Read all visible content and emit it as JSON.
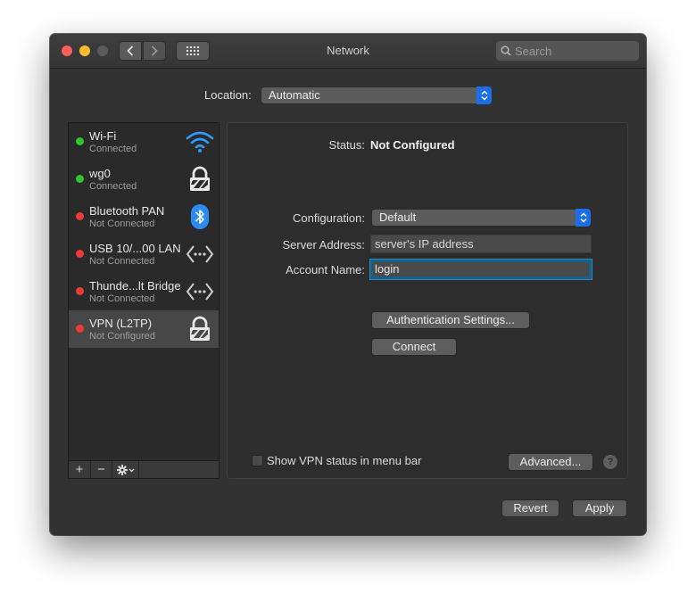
{
  "window": {
    "title": "Network"
  },
  "toolbar": {
    "search_placeholder": "Search"
  },
  "location": {
    "label": "Location:",
    "value": "Automatic"
  },
  "services": [
    {
      "name": "Wi-Fi",
      "status": "Connected",
      "status_color": "#2fc52e",
      "icon": "wifi-icon"
    },
    {
      "name": "wg0",
      "status": "Connected",
      "status_color": "#2fc52e",
      "icon": "lock-icon"
    },
    {
      "name": "Bluetooth PAN",
      "status": "Not Connected",
      "status_color": "#ef3b36",
      "icon": "bluetooth-icon"
    },
    {
      "name": "USB 10/...00 LAN",
      "status": "Not Connected",
      "status_color": "#ef3b36",
      "icon": "ethernet-icon"
    },
    {
      "name": "Thunde...lt Bridge",
      "status": "Not Connected",
      "status_color": "#ef3b36",
      "icon": "ethernet-icon"
    },
    {
      "name": "VPN (L2TP)",
      "status": "Not Configured",
      "status_color": "#ef3b36",
      "icon": "lock-icon",
      "selected": true
    }
  ],
  "sidebar_toolbar": {
    "add": "+",
    "remove": "−"
  },
  "detail": {
    "status_label": "Status:",
    "status_value": "Not Configured",
    "configuration_label": "Configuration:",
    "configuration_value": "Default",
    "server_label": "Server Address:",
    "server_value": "server's IP address",
    "account_label": "Account Name:",
    "account_value": "login",
    "auth_button": "Authentication Settings...",
    "connect_button": "Connect",
    "show_vpn_label": "Show VPN status in menu bar",
    "advanced_button": "Advanced...",
    "help": "?"
  },
  "footer": {
    "revert": "Revert",
    "apply": "Apply"
  },
  "colors": {
    "accent": "#1b6ee8",
    "focus_ring": "#2f88bd",
    "wifi": "#2f9bff",
    "bluetooth": "#2a8cf0"
  }
}
